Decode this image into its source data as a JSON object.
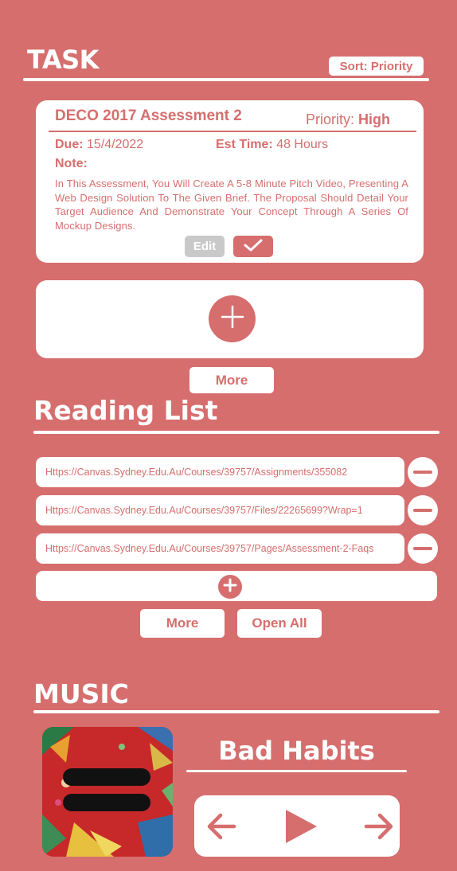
{
  "task_section": {
    "title": "TASK",
    "sort_label": "Sort: Priority"
  },
  "task_card": {
    "title": "DECO 2017 Assessment 2",
    "priority_label": "Priority:",
    "priority_value": "High",
    "due_label": "Due:",
    "due_value": "15/4/2022",
    "est_label": "Est Time:",
    "est_value": "48 Hours",
    "note_label": "Note:",
    "note_text": "In This Assessment, You Will Create A 5-8 Minute Pitch Video, Presenting A Web Design Solution To The Given Brief. The Proposal Should Detail Your Target Audience And Demonstrate Your Concept Through A Series Of Mockup Designs.",
    "edit_label": "Edit"
  },
  "task_more_label": "More",
  "reading_list": {
    "title": "Reading List",
    "links": [
      "Https://Canvas.Sydney.Edu.Au/Courses/39757/Assignments/355082",
      "Https://Canvas.Sydney.Edu.Au/Courses/39757/Files/22265699?Wrap=1",
      "Https://Canvas.Sydney.Edu.Au/Courses/39757/Pages/Assessment-2-Faqs"
    ],
    "more_label": "More",
    "open_all_label": "Open All"
  },
  "music": {
    "title": "MUSIC",
    "song_title": "Bad Habits"
  },
  "colors": {
    "background": "#d66e6e",
    "card": "#ffffff",
    "edit_button": "#c9c9c9"
  },
  "icons": [
    "check-icon",
    "plus-icon",
    "minus-icon",
    "arrow-left-icon",
    "play-icon",
    "arrow-right-icon"
  ]
}
